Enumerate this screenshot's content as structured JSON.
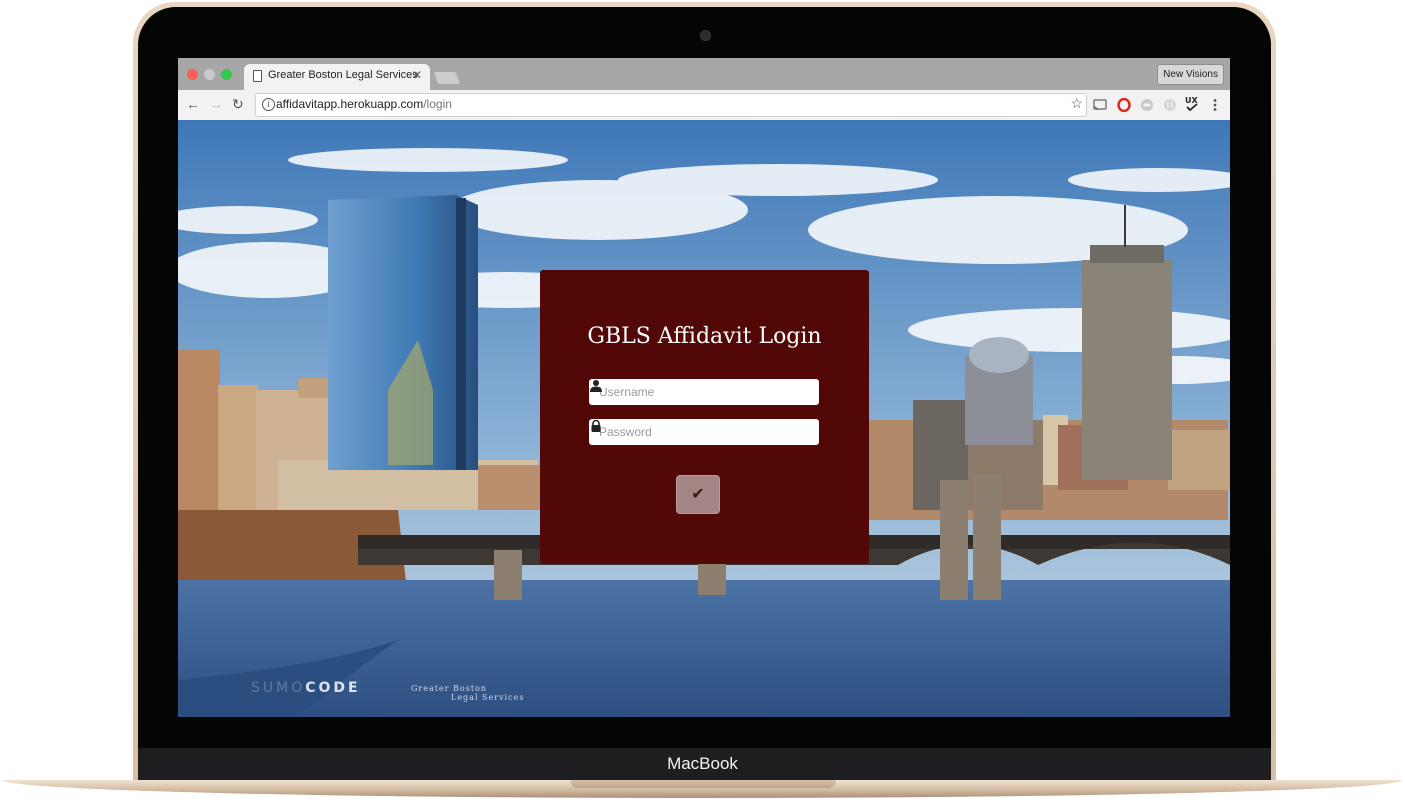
{
  "device": {
    "brand_label": "MacBook"
  },
  "browser": {
    "tab": {
      "title": "Greater Boston Legal Services",
      "close_glyph": "✕"
    },
    "profile_button": "New Visions",
    "nav": {
      "back_glyph": "←",
      "forward_glyph": "→",
      "reload_glyph": "↻"
    },
    "address": {
      "host": "affidavitapp.herokuapp.com",
      "path": "/login"
    },
    "icons": [
      "info-icon",
      "star-icon",
      "cast-icon",
      "opera-icon",
      "extension-icon",
      "extension-icon",
      "ux-check-icon",
      "menu-kebab-icon"
    ]
  },
  "login": {
    "title": "GBLS Affidavit Login",
    "username_placeholder": "Username",
    "password_placeholder": "Password",
    "submit_glyph": "✔"
  },
  "footer": {
    "code_logo_dim": "SUMO",
    "code_logo_bold": "CODE",
    "gbls_logo_line1": "Greater Boston",
    "gbls_logo_line2": "Legal Services"
  },
  "colors": {
    "card": "#510807",
    "submit": "#a48586",
    "lid": "#e0c9b2"
  }
}
